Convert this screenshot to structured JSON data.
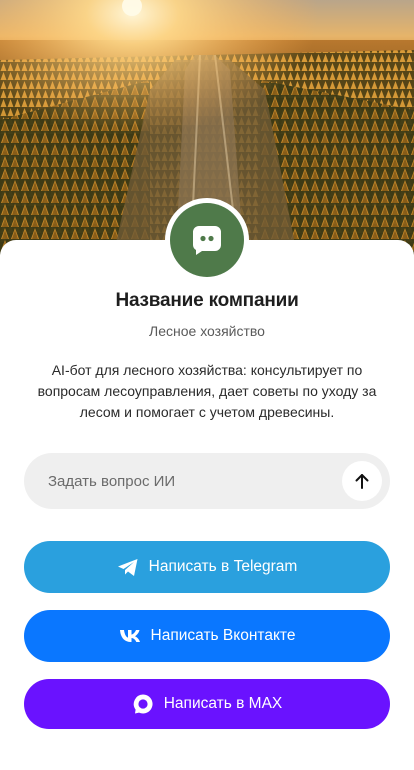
{
  "hero": {
    "image_icon": "forest-landscape-image"
  },
  "company": {
    "name": "Название компании",
    "category": "Лесное хозяйство",
    "description": "AI-бот для лесного хозяйства: консультирует по вопросам лесоуправления, дает советы по уходу за лесом и помогает с учетом древесины.",
    "avatar_icon": "chat-bot-icon",
    "avatar_color": "#4f7a4a"
  },
  "ask": {
    "placeholder": "Задать вопрос ИИ",
    "value": "",
    "send_icon": "arrow-up-icon"
  },
  "buttons": {
    "telegram": {
      "label": "Написать в Telegram",
      "icon": "telegram-icon",
      "color": "#2aa0de"
    },
    "vk": {
      "label": "Написать Вконтакте",
      "icon": "vk-icon",
      "color": "#0a77ff"
    },
    "max": {
      "label": "Написать в MAX",
      "icon": "max-icon",
      "color": "#6a12ff"
    }
  }
}
